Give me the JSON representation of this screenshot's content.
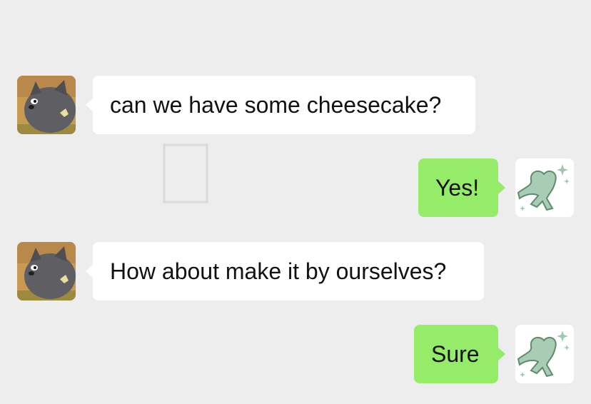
{
  "chat": {
    "background_color": "#ededed",
    "incoming_bubble_color": "#ffffff",
    "outgoing_bubble_color": "#95ec69",
    "messages": [
      {
        "side": "incoming",
        "sender_avatar": "gray-cat-avatar",
        "text": "can we have some cheesecake?"
      },
      {
        "side": "outgoing",
        "sender_avatar": "green-dancing-figure-avatar",
        "text": "Yes!"
      },
      {
        "side": "incoming",
        "sender_avatar": "gray-cat-avatar",
        "text": "How about make it by ourselves?"
      },
      {
        "side": "outgoing",
        "sender_avatar": "green-dancing-figure-avatar",
        "text": "Sure"
      }
    ]
  }
}
